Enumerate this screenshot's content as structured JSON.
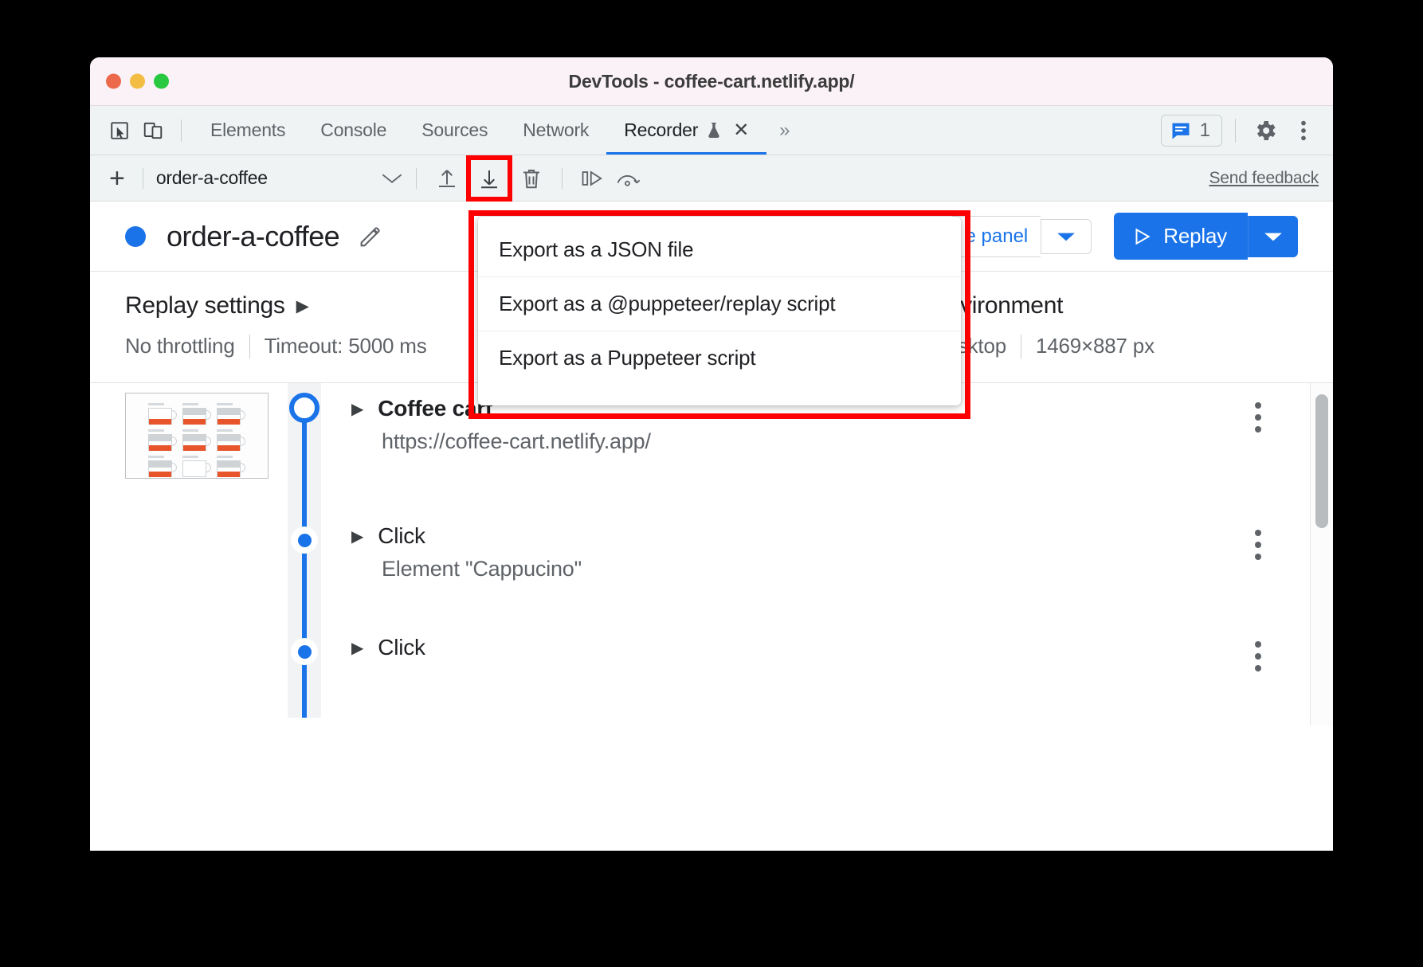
{
  "window": {
    "title": "DevTools - coffee-cart.netlify.app/",
    "traffic_lights": [
      "close",
      "minimize",
      "zoom"
    ]
  },
  "tabbar": {
    "inspect_icon": "inspect-cursor-icon",
    "device_icon": "device-toolbar-icon",
    "tabs": [
      {
        "label": "Elements",
        "active": false
      },
      {
        "label": "Console",
        "active": false
      },
      {
        "label": "Sources",
        "active": false
      },
      {
        "label": "Network",
        "active": false
      },
      {
        "label": "Recorder",
        "active": true,
        "flask": true,
        "closeable": true
      }
    ],
    "more_tabs": "»",
    "issues_count": "1",
    "settings_icon": "gear-icon",
    "more_icon": "kebab-icon"
  },
  "recorder_toolbar": {
    "add_label": "+",
    "recording_name": "order-a-coffee",
    "caret": "∨",
    "import_icon": "import-arrow-up-icon",
    "export_icon": "export-arrow-down-icon",
    "delete_icon": "trash-icon",
    "step_icon": "step-over-icon",
    "replay_speed_icon": "replay-speed-icon",
    "send_feedback": "Send feedback"
  },
  "export_menu": {
    "items": [
      "Export as a JSON file",
      "Export as a @puppeteer/replay script",
      "Export as a Puppeteer script"
    ]
  },
  "recording_header": {
    "status_dot": "blue",
    "title": "order-a-coffee",
    "edit_icon": "pencil-icon",
    "code_panel_label": "e panel",
    "code_caret": "▾",
    "replay_label": "Replay",
    "replay_play_icon": "play-triangle-icon",
    "replay_caret": "▾"
  },
  "settings": {
    "replay": {
      "title": "Replay settings",
      "expand_icon": "▶",
      "throttling": "No throttling",
      "timeout": "Timeout: 5000 ms"
    },
    "environment": {
      "title": "Environment",
      "device": "Desktop",
      "viewport": "1469×887 px"
    }
  },
  "steps": [
    {
      "title": "Coffee cart",
      "subtitle": "https://coffee-cart.netlify.app/",
      "bold": true,
      "marker": "ring",
      "has_thumbnail": true,
      "kebab": "step-menu-icon"
    },
    {
      "title": "Click",
      "subtitle": "Element \"Cappucino\"",
      "bold": false,
      "marker": "dot",
      "has_thumbnail": false,
      "kebab": "step-menu-icon"
    },
    {
      "title": "Click",
      "subtitle": "",
      "bold": false,
      "marker": "dot",
      "has_thumbnail": false,
      "kebab": "step-menu-icon"
    }
  ],
  "colors": {
    "accent": "#1a73e8",
    "highlight": "#ff0000",
    "titlebar": "#fbf2f7",
    "toolbar": "#eff3f4",
    "text": "#202124",
    "muted": "#5f6368"
  }
}
